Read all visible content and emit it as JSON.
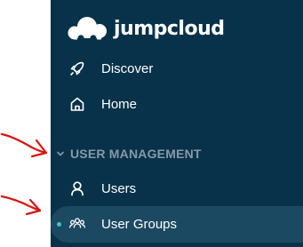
{
  "app": {
    "brand": "jumpcloud"
  },
  "nav": {
    "discover": "Discover",
    "home": "Home",
    "section_user_management": "USER MANAGEMENT",
    "users": "Users",
    "user_groups": "User Groups"
  },
  "colors": {
    "sidebar_bg": "#08324a",
    "active_bg": "#1c4962",
    "section_text": "#8699a6",
    "active_dot": "#3fc4c9",
    "annotation": "#d9140f"
  },
  "icons": {
    "logo": "cloud-logo-icon",
    "discover": "rocket-icon",
    "home": "home-icon",
    "section": "chevron-down-icon",
    "users": "user-icon",
    "user_groups": "user-group-icon"
  }
}
